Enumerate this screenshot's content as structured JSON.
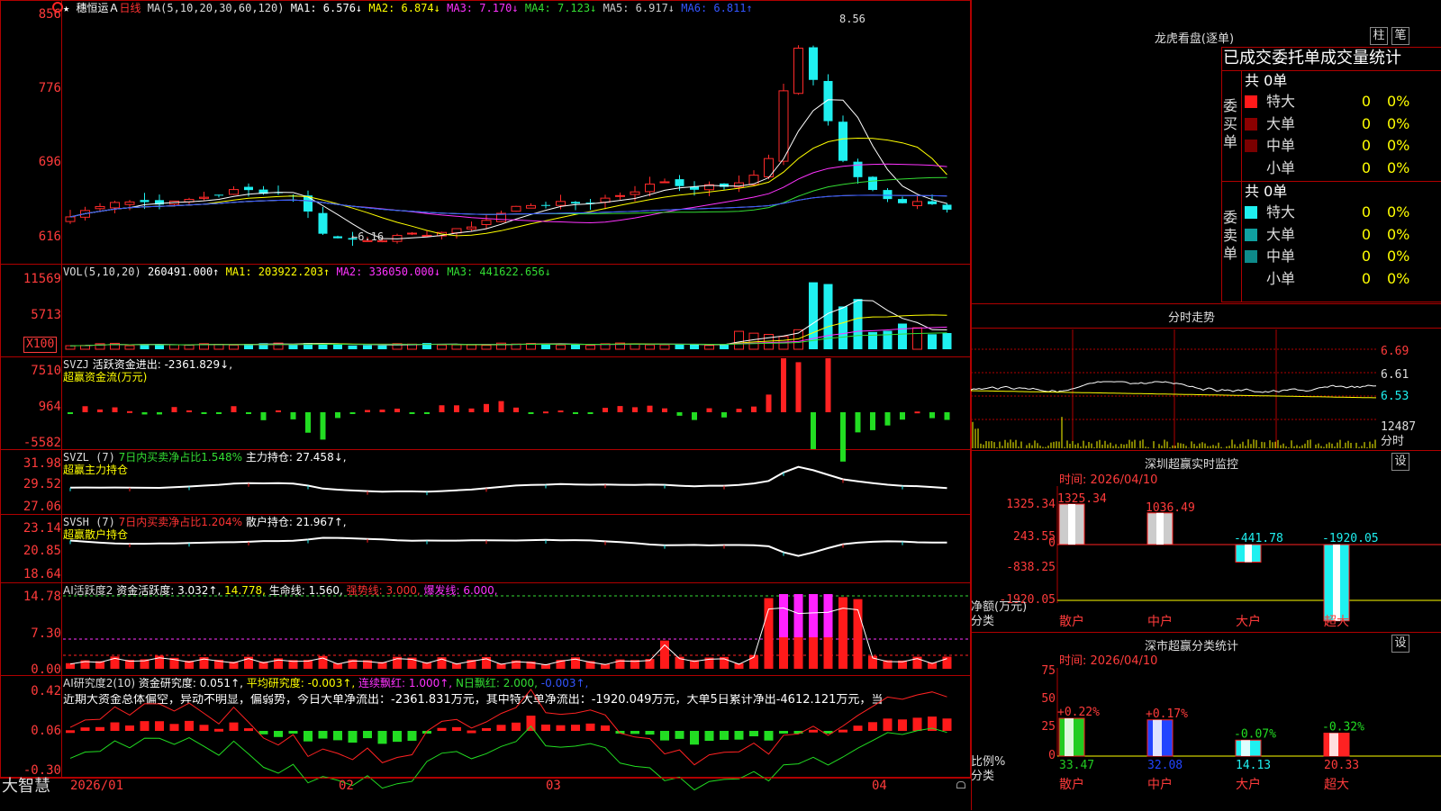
{
  "header": {
    "stock_name": "穗恒运Ａ",
    "period": "日线",
    "ma_label": "MA(5,10,20,30,60,120)",
    "ma1": "MA1: 6.576↓",
    "ma2": "MA2: 6.874↓",
    "ma3": "MA3: 7.170↓",
    "ma4": "MA4: 7.123↓",
    "ma5": "MA5: 6.917↓",
    "ma6": "MA6: 6.811↑",
    "star": "★"
  },
  "price_axis": [
    "856",
    "776",
    "696",
    "616"
  ],
  "price_annotations": {
    "high": "8.56",
    "low": "6.16"
  },
  "vol": {
    "label": "VOL(5,10,20)",
    "value": "260491.000↑",
    "ma1": "MA1: 203922.203↑",
    "ma2": "MA2: 336050.000↓",
    "ma3": "MA3: 441622.656↓",
    "axis": [
      "11569",
      "5713",
      "X100"
    ]
  },
  "svzj": {
    "label": "SVZJ",
    "text": "活跃资金进出: -2361.829↓,",
    "sub": "超赢资金流(万元)",
    "axis": [
      "7510",
      "964",
      "-5582"
    ]
  },
  "svzl": {
    "label": "SVZL (7)",
    "text1": "7日内买卖净占比1.548%",
    "text2": "主力持仓: 27.458↓,",
    "sub": "超赢主力持仓",
    "axis": [
      "31.98",
      "29.52",
      "27.06"
    ]
  },
  "svsh": {
    "label": "SVSH (7)",
    "text1": "7日内买卖净占比1.204%",
    "text2": "散户持仓: 21.967↑,",
    "sub": "超赢散户持仓",
    "axis": [
      "23.14",
      "20.85",
      "18.64"
    ]
  },
  "ai1": {
    "label": "AI活跃度2",
    "t1": "资金活跃度: 3.032↑,",
    "t2": "14.778,",
    "t3": "生命线: 1.560,",
    "t4": "强势线: 3.000,",
    "t5": "爆发线: 6.000,",
    "axis": [
      "14.78",
      "7.30",
      "0.00"
    ]
  },
  "ai2": {
    "label": "AI研究度2(10)",
    "t1": "资金研究度: 0.051↑,",
    "t2": "平均研究度: -0.003↑,",
    "t3": "连续飘红: 1.000↑,",
    "t4": "N日飘红: 2.000,",
    "t5": "-0.003↑,",
    "desc": "近期大资金总体偏空，异动不明显，偏弱势，今日大单净流出：-2361.831万元，其中特大单净流出：-1920.049万元，大单5日累计净出-4612.121万元，当",
    "axis": [
      "0.42",
      "0.06",
      "-0.30"
    ]
  },
  "bottom": {
    "brand": "大智慧",
    "dates": [
      "2026/01",
      "02",
      "03",
      "04"
    ]
  },
  "right": {
    "lhkp_title": "龙虎看盘(逐单)",
    "btn_column": "柱",
    "btn_pen": "笔",
    "stats_title": "已成交委托单成交量统计",
    "buy_side": "委买单",
    "sell_side": "委卖单",
    "buy_total": "共 0单",
    "sell_total": "共 0单",
    "buy_rows": [
      {
        "label": "特大",
        "count": "0",
        "pct": "0%",
        "color": "#ff1a1a"
      },
      {
        "label": "大单",
        "count": "0",
        "pct": "0%",
        "color": "#8b0000"
      },
      {
        "label": "中单",
        "count": "0",
        "pct": "0%",
        "color": "#7a0000"
      },
      {
        "label": "小单",
        "count": "0",
        "pct": "0%",
        "color": ""
      }
    ],
    "sell_rows": [
      {
        "label": "特大",
        "count": "0",
        "pct": "0%",
        "color": "#1ff0f0"
      },
      {
        "label": "大单",
        "count": "0",
        "pct": "0%",
        "color": "#10a0a0"
      },
      {
        "label": "中单",
        "count": "0",
        "pct": "0%",
        "color": "#0e8a8a"
      },
      {
        "label": "小单",
        "count": "0",
        "pct": "0%",
        "color": ""
      }
    ],
    "intraday_title": "分时走势",
    "intraday_axis": [
      "6.69",
      "6.61",
      "6.53",
      "12487",
      "分时"
    ],
    "monitor_title": "深圳超赢实时监控",
    "monitor_btn": "设",
    "monitor_time": "时间: 2026/04/10",
    "monitor_axis": [
      "1325.34",
      "243.55",
      "0",
      "-838.25",
      "-1920.05"
    ],
    "monitor_bars": [
      {
        "cat": "散户",
        "value": "1325.34",
        "num": 1325.34
      },
      {
        "cat": "中户",
        "value": "1036.49",
        "num": 1036.49
      },
      {
        "cat": "大户",
        "value": "-441.78",
        "num": -441.78
      },
      {
        "cat": "超大",
        "value": "-1920.05",
        "num": -1920.05
      }
    ],
    "monitor_ylabel": "净额(万元)",
    "monitor_xlabel": "分类",
    "class_title": "深市超赢分类统计",
    "class_btn": "设",
    "class_time": "时间: 2026/04/10",
    "class_axis": [
      "75",
      "50",
      "25",
      "0"
    ],
    "class_bars": [
      {
        "cat": "散户",
        "delta": "+0.22%",
        "value": "33.47",
        "num": 33.47,
        "color": "#22cc22"
      },
      {
        "cat": "中户",
        "delta": "+0.17%",
        "value": "32.08",
        "num": 32.08,
        "color": "#2244ff"
      },
      {
        "cat": "大户",
        "delta": "-0.07%",
        "value": "14.13",
        "num": 14.13,
        "color": "#1ff0f0"
      },
      {
        "cat": "超大",
        "delta": "-0.32%",
        "value": "20.33",
        "num": 20.33,
        "color": "#ff2222"
      }
    ],
    "class_ylabel": "比例%",
    "class_xlabel": "分类"
  }
}
